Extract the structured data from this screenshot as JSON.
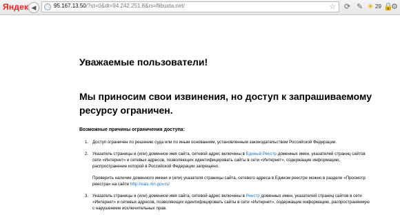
{
  "browser": {
    "brand": "Яндекс",
    "back_glyph": "◀",
    "url_host": "95.167.13.50",
    "url_rest": "/?st=0&dt=94.242.251.8&rs=flibusta.net/",
    "bookmark_icon": "star-icon",
    "temperature": "29"
  },
  "page": {
    "title": "Уважаемые пользователи!",
    "apology": "Мы приносим свои извинения, но доступ к запрашиваемому ресурсу ограничен.",
    "reasons_heading": "Возможные причины ограничения доступа:",
    "reasons": [
      {
        "num": "1.",
        "text": "Доступ ограничен  по решению суда или по иным основаниям, установленным законодательством Российской Федерации."
      },
      {
        "num": "2.",
        "before": "Указатель страницы и (или) доменное имя сайта, сетевой адрес включены в ",
        "link": "Единый Реестр",
        "after": " доменных имен, указателей страниц сайтов сети «Интернет» и сетевых адресов, позволяющих идентифицировать сайты в сети «Интернет», содержащие информацию, распространение которой в Российской Федерации запрещено.",
        "note_before": "Проверить наличие доменного имени и (или) указателя страницы сайта, сетевого адреса в Едином реестре можно в разделе «Просмотр реестра» на сайте ",
        "note_link": "http://eais.rkn.gov.ru/"
      },
      {
        "num": "3.",
        "before": "Указатель страницы и (или) доменное имя сайта, сетевой адрес включены в ",
        "link": "Реестр",
        "after": " доменных имен, указателей страниц сайтов в сети «Интернет» и сетевых адресов, позволяющих идентифицировать сайты в сети «Интернет», содержащие информацию, распространяемую с нарушением исключительных прав."
      }
    ]
  },
  "colors": {
    "brand": "#e52620",
    "link": "#1a6fc9"
  }
}
